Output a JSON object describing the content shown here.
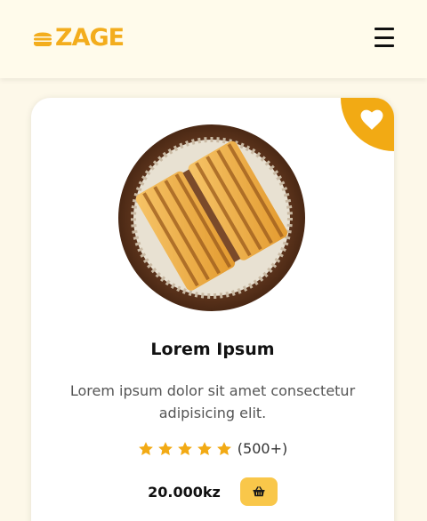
{
  "header": {
    "logo_text": "ZAGE",
    "logo_icon": "burger-icon",
    "menu_icon": "hamburger-menu-icon"
  },
  "product": {
    "title": "Lorem Ipsum",
    "description": "Lorem ipsum dolor sit amet consectetur adipisicing elit.",
    "rating": 5,
    "rating_max": 5,
    "rating_count": "(500+)",
    "price": "20.000kz",
    "favorite_icon": "heart-icon",
    "cart_icon": "basket-icon"
  },
  "colors": {
    "accent": "#f2aa14",
    "cart_button": "#f9c74a",
    "background": "#fdf8e9"
  }
}
